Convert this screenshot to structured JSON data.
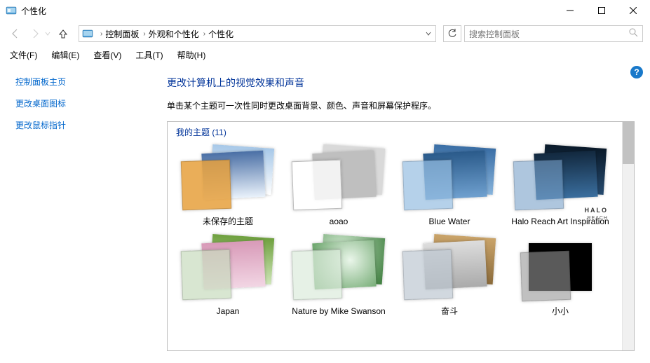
{
  "window": {
    "title": "个性化"
  },
  "breadcrumb": {
    "items": [
      "控制面板",
      "外观和个性化",
      "个性化"
    ]
  },
  "search": {
    "placeholder": "搜索控制面板"
  },
  "menu": {
    "file": "文件(F)",
    "edit": "编辑(E)",
    "view": "查看(V)",
    "tools": "工具(T)",
    "help": "帮助(H)"
  },
  "sidebar": {
    "home": "控制面板主页",
    "desktop_icons": "更改桌面图标",
    "mouse_pointers": "更改鼠标指针"
  },
  "main": {
    "title": "更改计算机上的视觉效果和声音",
    "subtitle": "单击某个主题可一次性同时更改桌面背景、颜色、声音和屏幕保护程序。",
    "section_label_prefix": "我的主题",
    "section_count": "(11)"
  },
  "themes": [
    {
      "name": "未保存的主题"
    },
    {
      "name": "aoao"
    },
    {
      "name": "Blue Water"
    },
    {
      "name": "Halo Reach Art Inspiration"
    },
    {
      "name": "Japan"
    },
    {
      "name": "Nature by Mike Swanson"
    },
    {
      "name": "奋斗"
    },
    {
      "name": "小小"
    }
  ],
  "halo": {
    "brand": "HALO",
    "sub": "REACH"
  },
  "help": {
    "badge": "?"
  }
}
